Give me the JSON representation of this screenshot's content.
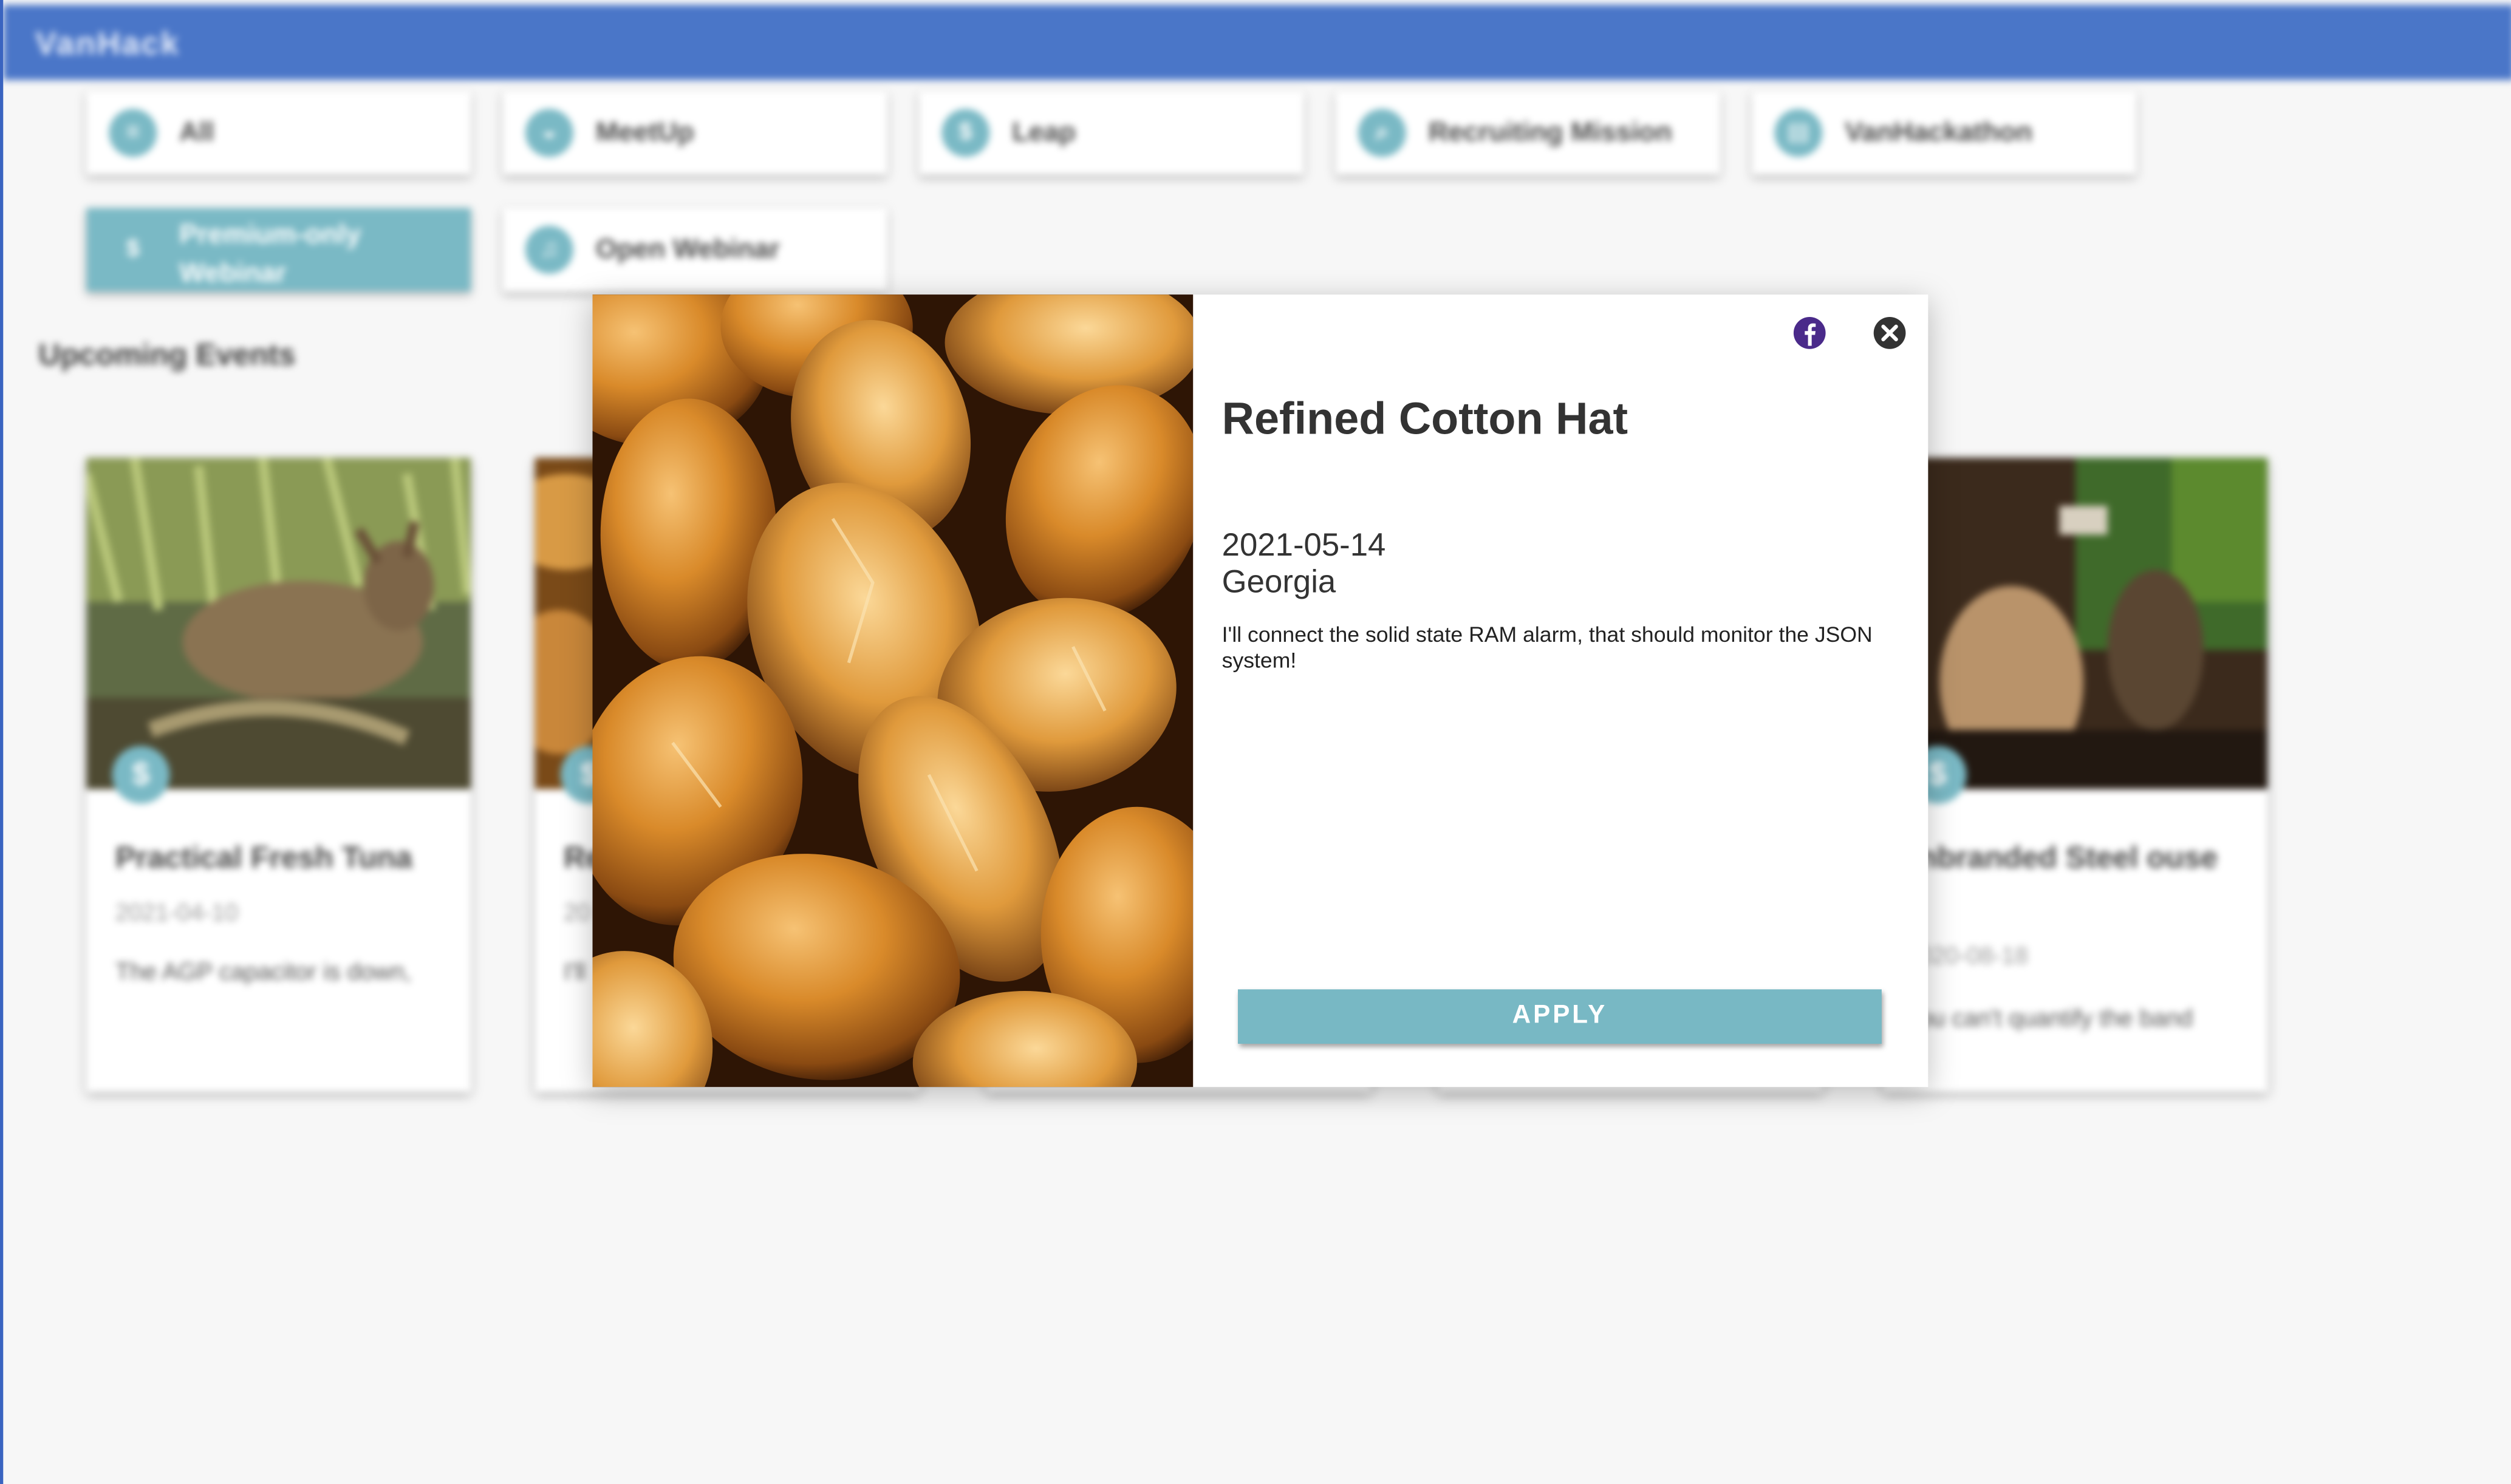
{
  "app": {
    "brand": "VanHack"
  },
  "filters": [
    {
      "label": "All",
      "icon": "all-events-icon",
      "glyph": "≡"
    },
    {
      "label": "MeetUp",
      "icon": "meetup-icon",
      "glyph": "◒"
    },
    {
      "label": "Leap",
      "icon": "dollar-icon",
      "glyph": "$"
    },
    {
      "label": "Recruiting Mission",
      "icon": "search-icon",
      "glyph": "⌕"
    },
    {
      "label": "VanHackathon",
      "icon": "hackathon-icon",
      "glyph": "▤"
    },
    {
      "label": "Premium-only Webinar",
      "icon": "dollar-icon",
      "glyph": "$",
      "active": true
    },
    {
      "label": "Open Webinar",
      "icon": "webinar-icon",
      "glyph": "♫"
    }
  ],
  "section": {
    "title": "Upcoming Events"
  },
  "cards": [
    {
      "title": "Practical Fresh Tuna",
      "date": "2021-04-10",
      "description": "The AGP capacitor is down,",
      "badge": "$"
    },
    {
      "title": "Re",
      "date": "20",
      "description": "I'll",
      "badge": "$"
    },
    {
      "title": "nbranded Steel ouse",
      "date": "020-08-18",
      "description": "ou can't quantify the band",
      "badge": "$"
    }
  ],
  "modal": {
    "title": "Refined Cotton Hat",
    "date": "2021-05-14",
    "location": "Georgia",
    "description": "I'll connect the solid state RAM alarm, that should monitor the JSON system!",
    "apply_label": "APPLY",
    "facebook_icon": "facebook-icon",
    "close_icon": "close-icon",
    "image_subject": "bread-rolls-photo"
  },
  "colors": {
    "appbar": "#4a76c8",
    "accent": "#7ab9c5",
    "facebook": "#4a2a8a",
    "close": "#333333"
  }
}
